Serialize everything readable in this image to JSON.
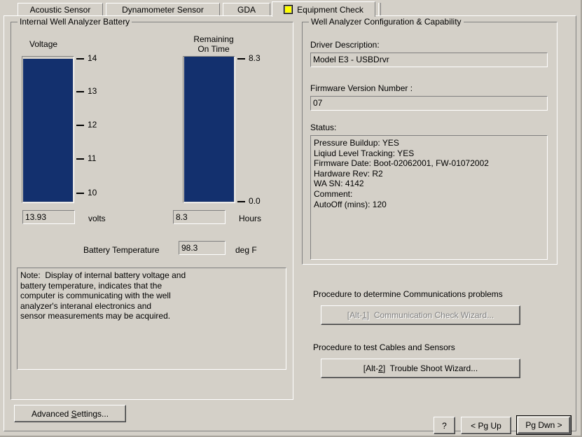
{
  "tabs": [
    {
      "label": "Acoustic Sensor",
      "active": false
    },
    {
      "label": "Dynamometer Sensor",
      "active": false
    },
    {
      "label": "GDA",
      "active": false
    },
    {
      "label": "Equipment Check",
      "active": true,
      "icon": "yellow-square-icon"
    }
  ],
  "battery_group": {
    "title": "Internal Well Analyzer Battery",
    "voltage": {
      "caption": "Voltage",
      "ticks": [
        "14",
        "13",
        "12",
        "11",
        "10"
      ],
      "value": "13.93",
      "unit": "volts",
      "scale_min": 10,
      "scale_max": 14,
      "fill_percent": 98
    },
    "remaining": {
      "caption_line1": "Remaining",
      "caption_line2": "On Time",
      "ticks": [
        "8.3",
        "0.0"
      ],
      "value": "8.3",
      "unit": "Hours",
      "scale_min": 0,
      "scale_max": 8.3,
      "fill_percent": 100
    },
    "temperature": {
      "label": "Battery Temperature",
      "value": "98.3",
      "unit": "deg F"
    },
    "note": "Note:  Display of internal battery voltage and\nbattery temperature, indicates that the\ncomputer is communicating with the well\nanalyzer's interanal electronics and\nsensor measurements may be acquired."
  },
  "config_group": {
    "title": "Well Analyzer Configuration & Capability",
    "driver_label": "Driver Description:",
    "driver_value": "Model E3 - USBDrvr",
    "firmware_label": "Firmware Version Number :",
    "firmware_value": "07",
    "status_label": "Status:",
    "status_value": "Pressure Buildup: YES\nLiqiud Level Tracking: YES\nFirmware Date: Boot-02062001, FW-01072002\nHardware Rev: R2\nWA SN: 4142\nComment:\nAutoOff (mins): 120"
  },
  "procedures": {
    "comm_label": "Procedure to determine Communications problems",
    "comm_button": {
      "prefix": "[Alt-",
      "key": "1",
      "suffix": "]  Communication Check Wizard...",
      "enabled": false
    },
    "cable_label": "Procedure to test Cables and Sensors",
    "cable_button": {
      "prefix": "[Alt-",
      "key": "2",
      "suffix": "]  Trouble Shoot Wizard...",
      "enabled": true
    }
  },
  "footer": {
    "advanced": {
      "pre": "Advanced ",
      "key": "S",
      "post": "ettings..."
    },
    "help": "?",
    "page_up": "< Pg Up",
    "page_down": "Pg Dwn >"
  },
  "colors": {
    "background": "#d4d0c8",
    "gauge_fill": "#13306e",
    "tab_icon": "#ffff00",
    "disabled_text": "#808080"
  }
}
